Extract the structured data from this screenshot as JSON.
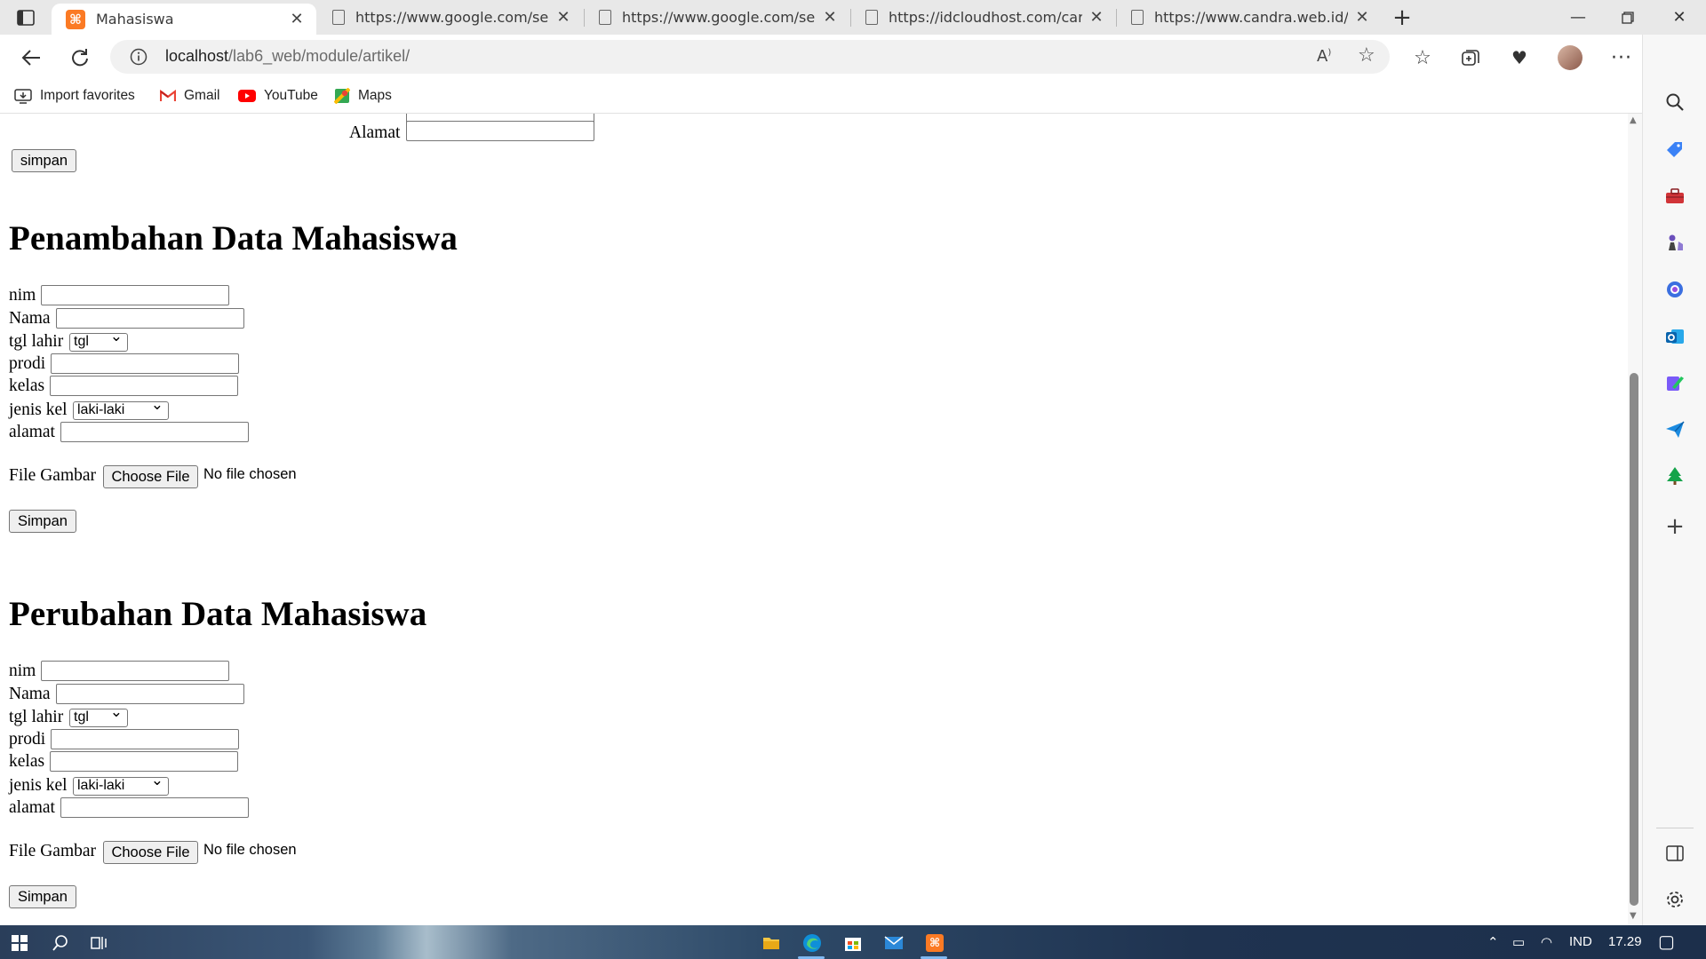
{
  "browser": {
    "tabs": [
      {
        "title": "Mahasiswa",
        "active": true,
        "favicon": "xampp-icon"
      },
      {
        "title": "https://www.google.com/search?",
        "active": false,
        "favicon": "page-icon"
      },
      {
        "title": "https://www.google.com/search?",
        "active": false,
        "favicon": "page-icon"
      },
      {
        "title": "https://idcloudhost.com/cara-me",
        "active": false,
        "favicon": "page-icon"
      },
      {
        "title": "https://www.candra.web.id/tekni",
        "active": false,
        "favicon": "page-icon"
      }
    ],
    "new_tab": "+",
    "address": {
      "host": "localhost",
      "path": "/lab6_web/module/artikel/"
    },
    "favorites": [
      {
        "label": "Import favorites",
        "icon": "import-icon"
      },
      {
        "label": "Gmail",
        "icon": "gmail-icon"
      },
      {
        "label": "YouTube",
        "icon": "youtube-icon"
      },
      {
        "label": "Maps",
        "icon": "maps-icon"
      }
    ]
  },
  "page": {
    "top_form": {
      "alamat_label": "Alamat",
      "submit_label": "simpan"
    },
    "add_form": {
      "heading": "Penambahan Data Mahasiswa",
      "nim_label": "nim",
      "nama_label": "Nama",
      "tgl_label": "tgl lahir",
      "tgl_selected": "tgl",
      "prodi_label": "prodi",
      "kelas_label": "kelas",
      "jk_label": "jenis kel",
      "jk_selected": "laki-laki",
      "alamat_label": "alamat",
      "file_label": "File Gambar",
      "choose_label": "Choose File",
      "nofile_text": "No file chosen",
      "submit_label": "Simpan"
    },
    "edit_form": {
      "heading": "Perubahan Data Mahasiswa",
      "nim_label": "nim",
      "nama_label": "Nama",
      "tgl_label": "tgl lahir",
      "tgl_selected": "tgl",
      "prodi_label": "prodi",
      "kelas_label": "kelas",
      "jk_label": "jenis kel",
      "jk_selected": "laki-laki",
      "alamat_label": "alamat",
      "file_label": "File Gambar",
      "choose_label": "Choose File",
      "nofile_text": "No file chosen",
      "submit_label": "Simpan"
    }
  },
  "taskbar": {
    "language": "IND",
    "time": "17.29"
  },
  "colors": {
    "tabstrip": "#e8e8e8",
    "accent_edge": "#0078d4",
    "xampp": "#fb7a24",
    "youtube": "#ff0000"
  }
}
